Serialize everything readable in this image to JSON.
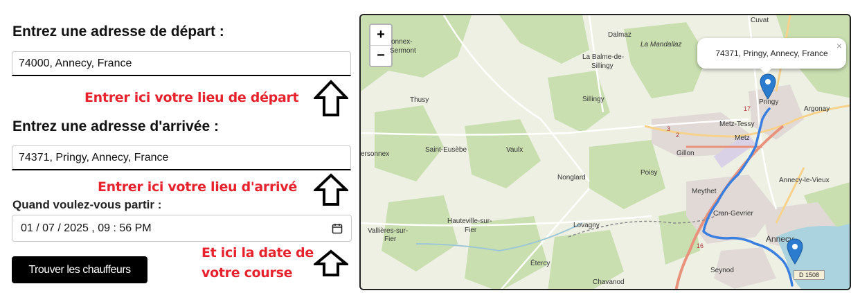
{
  "form": {
    "start_heading": "Entrez une adresse de départ :",
    "start_value": "74000, Annecy, France",
    "end_heading": "Entrez une adresse d'arrivée :",
    "end_value": "74371, Pringy, Annecy, France",
    "date_label": "Quand voulez-vous partir :",
    "date_value": "01 / 07 / 2025 ,  09 : 56   PM",
    "submit_label": "Trouver les chauffeurs"
  },
  "annotations": {
    "start_hint": "Entrer ici votre lieu de départ",
    "end_hint": "Entrer ici votre lieu d'arrivé",
    "date_hint_line1": "Et ici la date de",
    "date_hint_line2": "votre course"
  },
  "map": {
    "zoom_in": "+",
    "zoom_out": "−",
    "popup_text": "74371, Pringy, Annecy, France",
    "popup_close": "×",
    "road_badge": "D 1508",
    "place_labels": {
      "cuvat": "Cuvat",
      "dalmaz": "Dalmaz",
      "la_mandallaz": "La Mandallaz",
      "sonnex": "onnex-",
      "sermont": "Sermont",
      "balme": "La Balme-de-",
      "sillingy_a": "Sillingy",
      "sillingy_b": "Sillingy",
      "thusy": "Thusy",
      "pringy": "Pringy",
      "argonay": "Argonay",
      "metz_tessy": "Metz-Tessy",
      "metz": "Metz",
      "gillon": "Gillon",
      "personnex": "ersonnex",
      "saint_eusebe": "Saint-Eusèbe",
      "vaulx": "Vaulx",
      "poisy": "Poisy",
      "annecy_le_vieux": "Annecy-le-Vieux",
      "nonglard": "Nonglard",
      "meythet": "Meythet",
      "cran_gevrier": "Cran-Gevrier",
      "hauteville_a": "Hauteville-sur-",
      "hauteville_b": "Fier",
      "vallieres_a": "Vallières-sur-",
      "vallieres_b": "Fier",
      "lovagny": "Lovagny",
      "annecy": "Annecy",
      "etercy": "Étercy",
      "seynod": "Seynod",
      "chavanod": "Chavanod",
      "r17": "17",
      "r3": "3",
      "r2": "2",
      "r16": "16"
    }
  },
  "colors": {
    "annotation": "#e8222d",
    "route": "#3a7fe0",
    "marker": "#2b7ccf"
  }
}
